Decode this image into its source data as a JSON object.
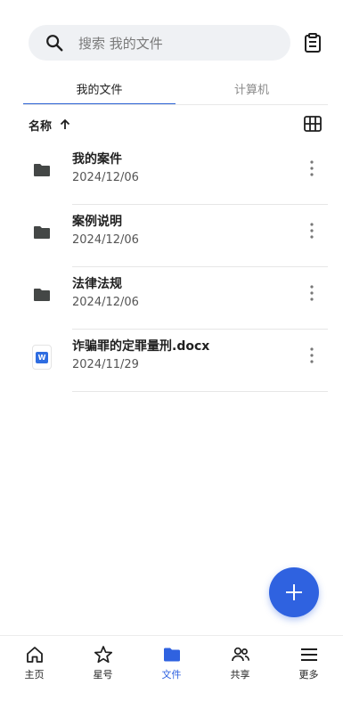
{
  "search": {
    "placeholder": "搜索 我的文件"
  },
  "tabs": [
    {
      "label": "我的文件",
      "active": true
    },
    {
      "label": "计算机",
      "active": false
    }
  ],
  "sort": {
    "label": "名称"
  },
  "files": [
    {
      "name": "我的案件",
      "date": "2024/12/06",
      "type": "folder"
    },
    {
      "name": "案例说明",
      "date": "2024/12/06",
      "type": "folder"
    },
    {
      "name": "法律法规",
      "date": "2024/12/06",
      "type": "folder"
    },
    {
      "name": "诈骗罪的定罪量刑.docx",
      "date": "2024/11/29",
      "type": "word",
      "badge": "W"
    }
  ],
  "bottom_nav": [
    {
      "label": "主页",
      "icon": "home-icon",
      "active": false
    },
    {
      "label": "星号",
      "icon": "star-icon",
      "active": false
    },
    {
      "label": "文件",
      "icon": "folder-icon",
      "active": true
    },
    {
      "label": "共享",
      "icon": "people-icon",
      "active": false
    },
    {
      "label": "更多",
      "icon": "menu-icon",
      "active": false
    }
  ],
  "colors": {
    "accent": "#2f62e0",
    "folder": "#444746",
    "search_bg": "#eff1f4"
  }
}
